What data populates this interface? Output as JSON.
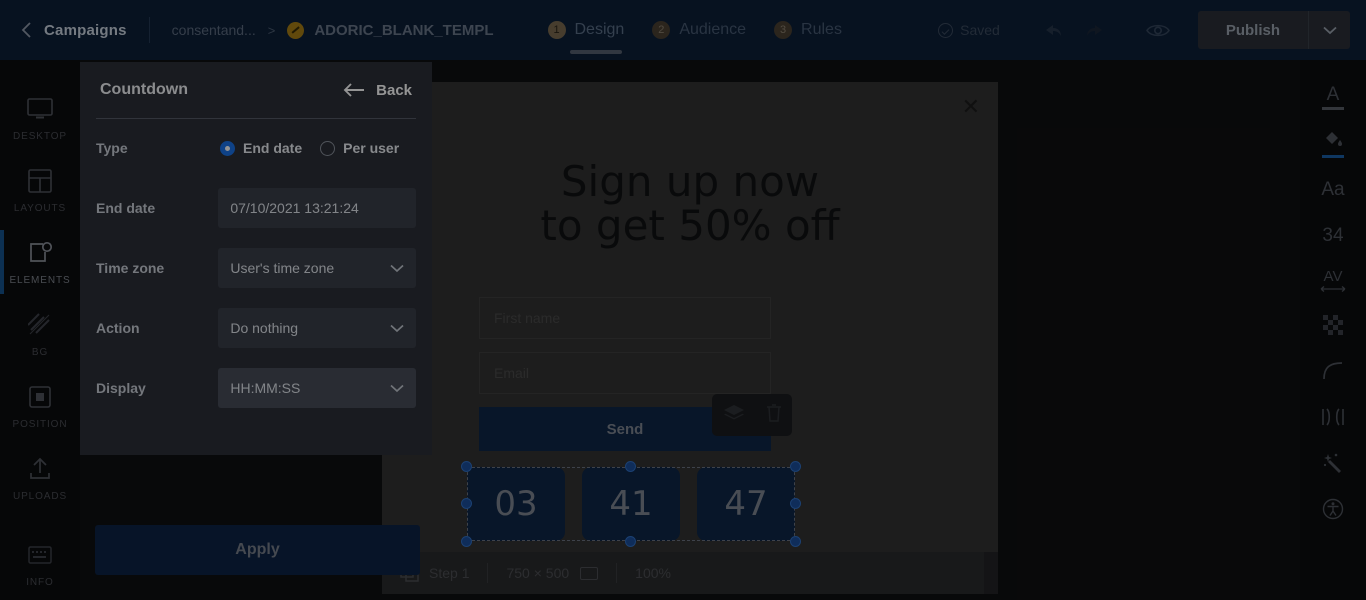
{
  "header": {
    "back_icon": "chevron-left-icon",
    "campaigns_label": "Campaigns",
    "breadcrumb_parent": "consentand...",
    "breadcrumb_separator": ">",
    "template_name": "ADORIC_BLANK_TEMPL",
    "steps": [
      {
        "num": "1",
        "label": "Design",
        "active": true
      },
      {
        "num": "2",
        "label": "Audience",
        "active": false
      },
      {
        "num": "3",
        "label": "Rules",
        "active": false
      }
    ],
    "saved_label": "Saved",
    "undo_icon": "undo-arrow-icon",
    "redo_icon": "redo-arrow-icon",
    "preview_icon": "eye-icon",
    "publish_label": "Publish",
    "publish_caret_icon": "chevron-down-icon"
  },
  "left_rail": {
    "items": [
      {
        "label": "DESKTOP",
        "icon": "monitor-icon",
        "active": false
      },
      {
        "label": "LAYOUTS",
        "icon": "layout-grid-icon",
        "active": false
      },
      {
        "label": "ELEMENTS",
        "icon": "elements-icon",
        "active": true
      },
      {
        "label": "BG",
        "icon": "background-stripes-icon",
        "active": false
      },
      {
        "label": "POSITION",
        "icon": "position-square-icon",
        "active": false
      },
      {
        "label": "UPLOADS",
        "icon": "upload-arrow-icon",
        "active": false
      },
      {
        "label": "INFO",
        "icon": "keyboard-info-icon",
        "active": false
      }
    ]
  },
  "right_rail": {
    "items": [
      {
        "icon": "text-color-icon",
        "text": "A",
        "underline": "gray"
      },
      {
        "icon": "fill-color-bucket-icon",
        "text": "",
        "underline": "blue"
      },
      {
        "icon": "font-family-icon",
        "text": "Aa",
        "underline": ""
      },
      {
        "icon": "font-size-icon",
        "text": "34",
        "underline": ""
      },
      {
        "icon": "letter-spacing-icon",
        "text": "AV",
        "underline": ""
      },
      {
        "icon": "opacity-checker-icon",
        "text": "",
        "underline": ""
      },
      {
        "icon": "border-radius-icon",
        "text": "",
        "underline": ""
      },
      {
        "icon": "padding-icon",
        "text": "",
        "underline": ""
      },
      {
        "icon": "magic-wand-icon",
        "text": "",
        "underline": ""
      },
      {
        "icon": "accessibility-icon",
        "text": "",
        "underline": ""
      }
    ]
  },
  "panel": {
    "title": "Countdown",
    "back_label": "Back",
    "back_icon": "arrow-left-icon",
    "type_label": "Type",
    "type_options": [
      {
        "label": "End date",
        "selected": true
      },
      {
        "label": "Per user",
        "selected": false
      }
    ],
    "end_date_label": "End date",
    "end_date_value": "07/10/2021 13:21:24",
    "timezone_label": "Time zone",
    "timezone_value": "User's time zone",
    "action_label": "Action",
    "action_value": "Do nothing",
    "display_label": "Display",
    "display_value": "HH:MM:SS",
    "apply_label": "Apply",
    "accent_color": "#1a73e8"
  },
  "canvas": {
    "close_icon": "close-x-icon",
    "headline_line1": "Sign up now",
    "headline_line2": "to get 50% off",
    "first_name_placeholder": "First name",
    "email_placeholder": "Email",
    "send_label": "Send",
    "countdown": [
      "03",
      "41",
      "47"
    ],
    "float_toolbar": [
      {
        "icon": "layers-icon"
      },
      {
        "icon": "trash-icon"
      }
    ],
    "rotate_icon": "rotate-handle-icon"
  },
  "statusbar": {
    "step_icon": "pages-icon",
    "step_label": "Step 1",
    "dimensions": "750 × 500",
    "device_icon": "desktop-rect-icon",
    "zoom": "100%"
  }
}
